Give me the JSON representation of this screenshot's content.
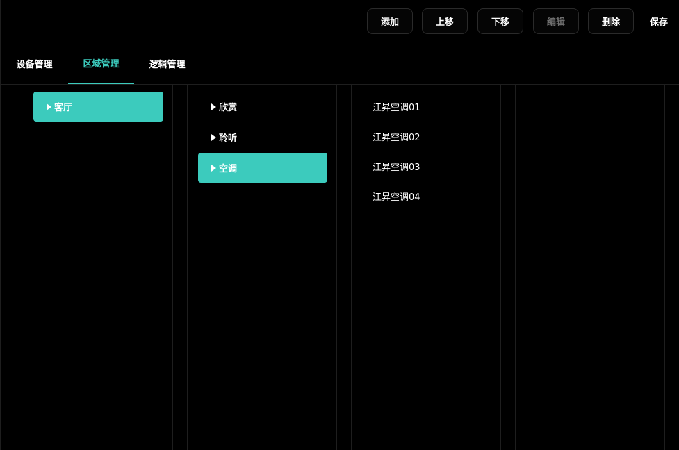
{
  "toolbar": {
    "add_label": "添加",
    "move_up_label": "上移",
    "move_down_label": "下移",
    "edit_label": "编辑",
    "delete_label": "删除",
    "save_label": "保存"
  },
  "tabs": [
    {
      "label": "设备管理",
      "active": false
    },
    {
      "label": "区域管理",
      "active": true
    },
    {
      "label": "逻辑管理",
      "active": false
    }
  ],
  "areas": [
    {
      "label": "客厅",
      "selected": true
    }
  ],
  "groups": [
    {
      "label": "欣赏",
      "selected": false
    },
    {
      "label": "聆听",
      "selected": false
    },
    {
      "label": "空调",
      "selected": true
    }
  ],
  "devices": [
    {
      "label": "江昇空调01"
    },
    {
      "label": "江昇空调02"
    },
    {
      "label": "江昇空调03"
    },
    {
      "label": "江昇空调04"
    }
  ],
  "colors": {
    "accent": "#3ccbbd",
    "background": "#000000",
    "divider": "#1e1e1e",
    "disabled_text": "#6e6e6e"
  }
}
